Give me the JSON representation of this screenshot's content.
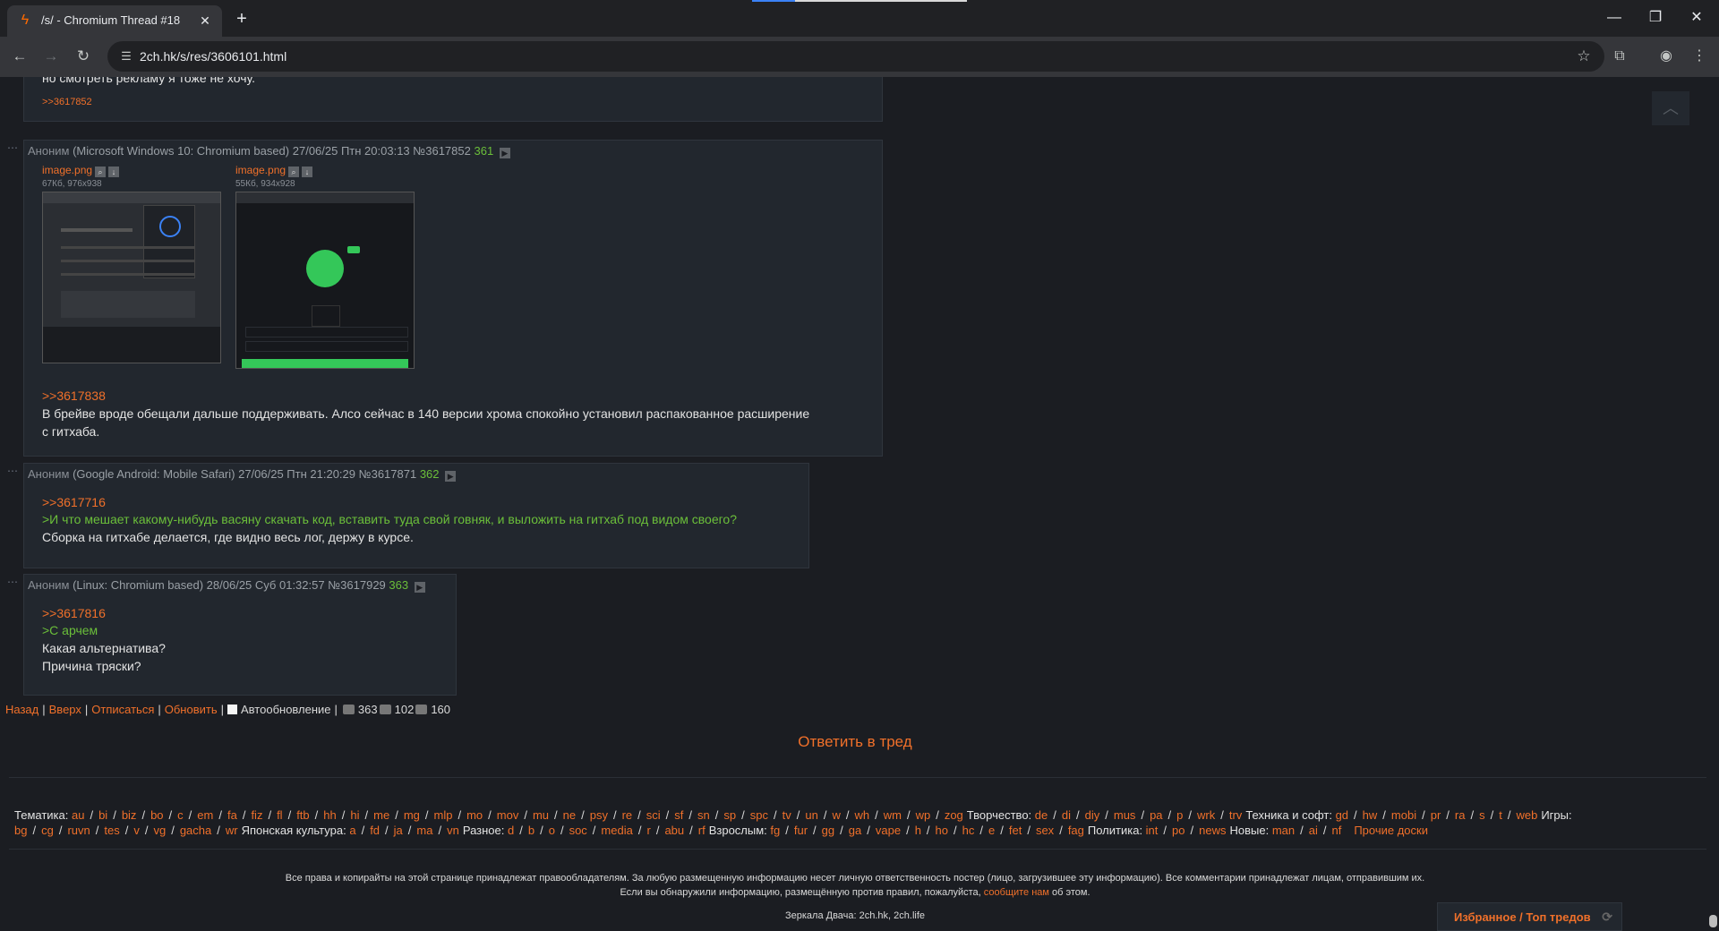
{
  "browser": {
    "tab_title": "/s/ - Chromium Thread #18",
    "tab_close": "✕",
    "new_tab": "+",
    "url": "2ch.hk/s/res/3606101.html",
    "window": {
      "minimize": "—",
      "restore": "❐",
      "close": "✕"
    }
  },
  "posts": {
    "p0": {
      "text_line": "но смотреть рекламу я тоже не хочу.",
      "reply": ">>3617852"
    },
    "p361": {
      "dots": "⋯",
      "anon": "Аноним",
      "ua": "(Microsoft Windows 10: Chromium based)",
      "date": "27/06/25 Птн 20:03:13",
      "num": "№3617852",
      "count": "361",
      "files": [
        {
          "name": "image.png",
          "meta": "67Кб, 976x938"
        },
        {
          "name": "image.png",
          "meta": "55Кб, 934x928"
        }
      ],
      "reply": ">>3617838",
      "line1": "В брейве вроде обещали дальше поддерживать. Алсо сейчас в 140 версии хрома спокойно установил распакованное расширение",
      "line2": "с гитхаба."
    },
    "p362": {
      "dots": "⋯",
      "anon": "Аноним",
      "ua": "(Google Android: Mobile Safari)",
      "date": "27/06/25 Птн 21:20:29",
      "num": "№3617871",
      "count": "362",
      "reply": ">>3617716",
      "quote": ">И что мешает какому-нибудь васяну скачать код, вставить туда свой говняк, и выложить на гитхаб под видом своего?",
      "line1": "Сборка на гитхабе делается, где видно весь лог, держу в курсе."
    },
    "p363": {
      "dots": "⋯",
      "anon": "Аноним",
      "ua": "(Linux: Chromium based)",
      "date": "28/06/25 Суб 01:32:57",
      "num": "№3617929",
      "count": "363",
      "reply": ">>3617816",
      "quote": ">С арчем",
      "line1": "Какая альтернатива?",
      "line2": "Причина тряски?"
    }
  },
  "nav": {
    "back": "Назад",
    "up": "Вверх",
    "unsubscribe": "Отписаться",
    "refresh": "Обновить",
    "autorefresh": "Автообновление",
    "posts_count": "363",
    "images_count": "102",
    "posters_count": "160"
  },
  "reply_thread": "Ответить в тред",
  "boards": {
    "line1_html_parts": [
      {
        "cat": "Тематика:",
        "items": [
          "au",
          "bi",
          "biz",
          "bo",
          "c",
          "em",
          "fa",
          "fiz",
          "fl",
          "ftb",
          "hh",
          "hi",
          "me",
          "mg",
          "mlp",
          "mo",
          "mov",
          "mu",
          "ne",
          "psy",
          "re",
          "sci",
          "sf",
          "sn",
          "sp",
          "spc",
          "tv",
          "un",
          "w",
          "wh",
          "wm",
          "wp",
          "zog"
        ]
      },
      {
        "cat": "Творчество:",
        "items": [
          "de",
          "di",
          "diy",
          "mus",
          "pa",
          "p",
          "wrk",
          "trv"
        ]
      },
      {
        "cat": "Техника и софт:",
        "items": [
          "gd",
          "hw",
          "mobi",
          "pr",
          "ra",
          "s",
          "t",
          "web"
        ]
      },
      {
        "cat": "Игры:",
        "items": [
          "bg",
          "cg",
          "ruvn",
          "tes",
          "v",
          "vg",
          "gacha",
          "wr"
        ]
      },
      {
        "cat": "Японская культура:",
        "items": [
          "a",
          "fd",
          "ja",
          "ma",
          "vn"
        ]
      },
      {
        "cat": "Разное:",
        "items": [
          "d",
          "b",
          "o",
          "soc",
          "media",
          "r",
          "abu",
          "rf"
        ]
      },
      {
        "cat": "Взрослым:",
        "items": [
          "fg",
          "fur",
          "gg",
          "ga",
          "vape",
          "h",
          "ho",
          "hc",
          "e",
          "fet",
          "sex",
          "fag"
        ]
      },
      {
        "cat": "Политика:",
        "items": [
          "int",
          "po",
          "news"
        ]
      },
      {
        "cat": "Новые:",
        "items": [
          "man",
          "ai",
          "nf"
        ]
      }
    ],
    "other": "Прочие доски"
  },
  "footer": {
    "copyright1": "Все права и копирайты на этой странице принадлежат правообладателям. За любую размещенную информацию несет личную ответственность постер (лицо, загрузившее эту информацию). Все комментарии принадлежат лицам, отправившим их.",
    "copyright2a": "Если вы обнаружили информацию, размещённую против правил, пожалуйста,",
    "copyright2b": "сообщите нам",
    "copyright2c": "об этом.",
    "mirrors": "Зеркала Двача: 2ch.hk, 2ch.life",
    "favorites": "Избранное / Топ тредов"
  },
  "colors": {
    "accent": "#f0702a",
    "quote": "#6bbf3a",
    "background": "#1b1d22",
    "post_bg": "#22272e"
  }
}
